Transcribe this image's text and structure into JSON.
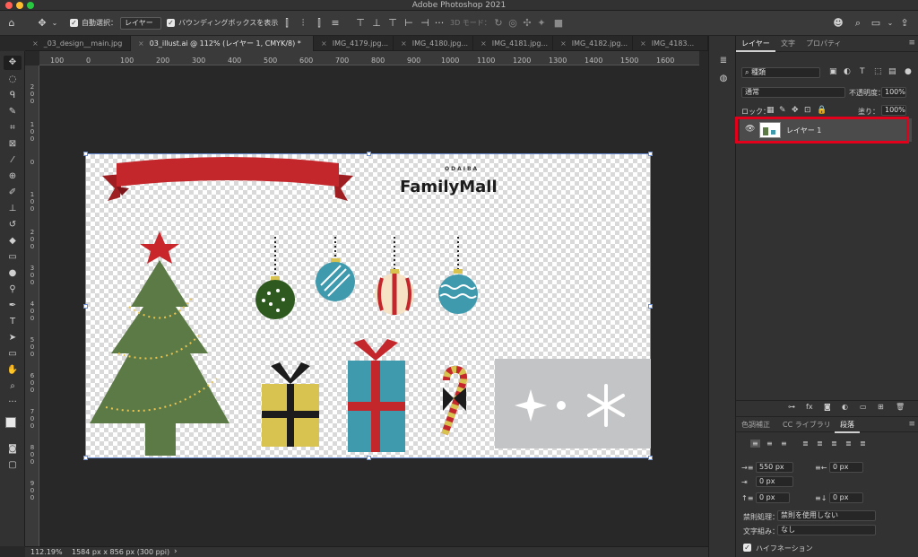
{
  "app": {
    "window_title": "Adobe Photoshop 2021",
    "traffic_light_colors": [
      "#ff5f57",
      "#febc2e",
      "#28c840"
    ]
  },
  "options_bar": {
    "auto_select_label": "自動選択：",
    "auto_select_value": "レイヤー",
    "show_bbox_label": "バウンディングボックスを表示",
    "mode_3d_label": "3D モード："
  },
  "tabs": [
    {
      "label": "_03_design__main.jpg",
      "active": false
    },
    {
      "label": "03_illust.ai @ 112% (レイヤー 1, CMYK/8) *",
      "active": true
    },
    {
      "label": "IMG_4179.jpg...",
      "active": false
    },
    {
      "label": "IMG_4180.jpg...",
      "active": false
    },
    {
      "label": "IMG_4181.jpg...",
      "active": false
    },
    {
      "label": "IMG_4182.jpg...",
      "active": false
    },
    {
      "label": "IMG_4183...",
      "active": false
    }
  ],
  "ruler": {
    "h_ticks": [
      "100",
      "0",
      "100",
      "200",
      "300",
      "400",
      "500",
      "600",
      "700",
      "800",
      "900",
      "1000",
      "1100",
      "1200",
      "1300",
      "1400",
      "1500",
      "1600"
    ],
    "v_ticks": [
      "2 0 0",
      "1 0 0",
      "0",
      "1 0 0",
      "2 0 0",
      "3 0 0",
      "4 0 0",
      "5 0 0",
      "6 0 0",
      "7 0 0",
      "8 0 0",
      "9 0 0"
    ]
  },
  "artwork": {
    "logo_small": "ODAIBA",
    "logo_big": "FamilyMall",
    "colors": {
      "red": "#c4272b",
      "green": "#5b7a45",
      "dark_green": "#2f5a1f",
      "teal": "#3f9aae",
      "yellow": "#d8c250",
      "star": "#c9262c",
      "gray_box": "#c3c4c5",
      "black": "#1c1c1c"
    }
  },
  "status": {
    "zoom": "112.19%",
    "doc_info": "1584 px x 856 px (300 ppi)"
  },
  "layers_panel": {
    "tabs": [
      "レイヤー",
      "文字",
      "プロパティ"
    ],
    "filter_value": "種類",
    "blend_mode": "通常",
    "opacity_label": "不透明度：",
    "opacity_value": "100%",
    "lock_label": "ロック：",
    "fill_label": "塗り：",
    "fill_value": "100%",
    "layers": [
      {
        "name": "レイヤー 1",
        "visible": true,
        "selected": true
      }
    ]
  },
  "paragraph_panel": {
    "tabs": [
      "色調補正",
      "CC ライブラリ",
      "段落"
    ],
    "indent_left": "550 px",
    "indent_right": "0 px",
    "indent_first": "0 px",
    "space_before": "0 px",
    "space_after": "0 px",
    "kinsoku_label": "禁則処理：",
    "kinsoku_value": "禁則を使用しない",
    "mojikumi_label": "文字組み：",
    "mojikumi_value": "なし",
    "hyphenate_label": "ハイフネーション"
  }
}
